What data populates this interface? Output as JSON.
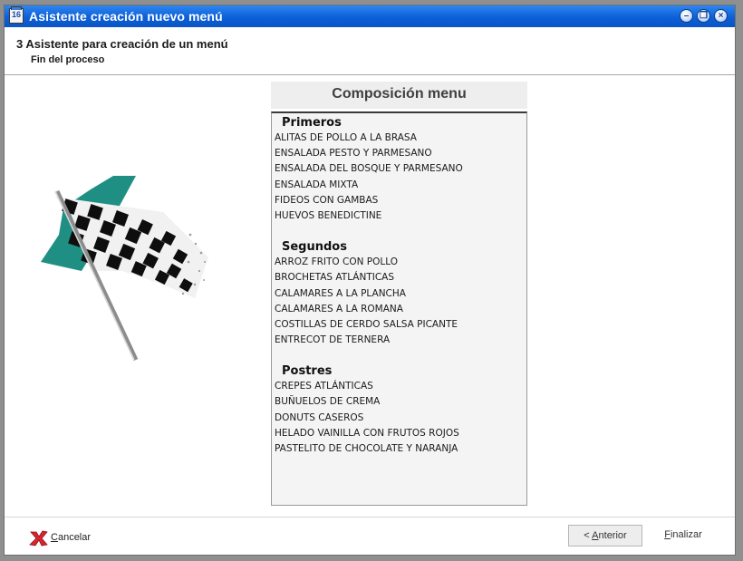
{
  "window": {
    "title": "Asistente creación nuevo menú",
    "icon_text": "16",
    "controls": [
      "minimize-icon",
      "restore-icon",
      "close-icon"
    ]
  },
  "step": {
    "title": "3 Asistente para creación de un menú",
    "subtitle": "Fin del proceso"
  },
  "composition": {
    "title": "Composición menu",
    "sections": [
      {
        "name": "Primeros",
        "items": [
          "ALITAS DE POLLO A LA BRASA",
          "ENSALADA PESTO Y PARMESANO",
          "ENSALADA DEL BOSQUE Y PARMESANO",
          "ENSALADA MIXTA",
          "FIDEOS CON GAMBAS",
          "HUEVOS BENEDICTINE"
        ]
      },
      {
        "name": "Segundos",
        "items": [
          "ARROZ FRITO CON POLLO",
          "BROCHETAS ATLÁNTICAS",
          "CALAMARES A LA PLANCHA",
          "CALAMARES A LA ROMANA",
          "COSTILLAS DE CERDO SALSA PICANTE",
          "ENTRECOT DE TERNERA"
        ]
      },
      {
        "name": "Postres",
        "items": [
          "CREPES ATLÁNTICAS",
          "BUÑUELOS DE CREMA",
          "DONUTS CASEROS",
          "HELADO VAINILLA CON FRUTOS ROJOS",
          "PASTELITO DE CHOCOLATE Y NARANJA"
        ]
      }
    ]
  },
  "footer": {
    "cancel_first": "C",
    "cancel_rest": "ancelar",
    "prev_prefix": "< ",
    "prev_mnemonic": "A",
    "prev_rest": "nterior",
    "finish_mnemonic": "F",
    "finish_rest": "inalizar"
  },
  "colors": {
    "titlebar": "#0c5fd7",
    "teal_flag": "#1f8f84",
    "cancel_icon": "#d8262f"
  }
}
